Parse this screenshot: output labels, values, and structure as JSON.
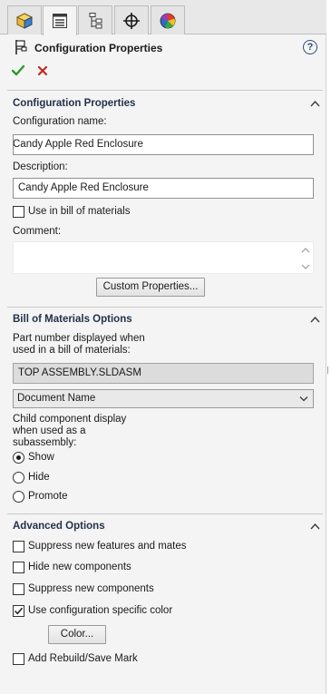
{
  "tabs": [
    {
      "name": "feature-manager",
      "icon": "feature-manager-cube-icon"
    },
    {
      "name": "property-manager",
      "icon": "property-manager-list-icon"
    },
    {
      "name": "configuration-manager",
      "icon": "configuration-manager-tree-icon"
    },
    {
      "name": "dimxpert-manager",
      "icon": "crosshair-target-icon"
    },
    {
      "name": "display-manager",
      "icon": "color-wheel-icon"
    }
  ],
  "header": {
    "title": "Configuration Properties",
    "help_glyph": "?",
    "icon": "configuration-flag-icon"
  },
  "actions": {
    "ok_icon": "green-checkmark-icon",
    "cancel_icon": "red-x-icon"
  },
  "config_section": {
    "title": "Configuration Properties",
    "name_label": "Configuration name:",
    "name_value": "Candy Apple Red Enclosure",
    "description_label": "Description:",
    "description_value": "Candy Apple Red Enclosure",
    "use_in_bom_label": "Use in bill of materials",
    "use_in_bom_checked": false,
    "comment_label": "Comment:",
    "comment_value": "",
    "custom_properties_button": "Custom Properties..."
  },
  "bom_section": {
    "title": "Bill of Materials Options",
    "part_number_label_line1": "Part number displayed when",
    "part_number_label_line2": "used in a bill of materials:",
    "part_number_value": "TOP ASSEMBLY.SLDASM",
    "part_number_source": "Document Name",
    "child_display_label_line1": "Child component display",
    "child_display_label_line2": "when used as a",
    "child_display_label_line3": "subassembly:",
    "options": [
      {
        "label": "Show",
        "selected": true
      },
      {
        "label": "Hide",
        "selected": false
      },
      {
        "label": "Promote",
        "selected": false
      }
    ]
  },
  "advanced_section": {
    "title": "Advanced Options",
    "checks": [
      {
        "label": "Suppress new features and mates",
        "checked": false
      },
      {
        "label": "Hide new components",
        "checked": false
      },
      {
        "label": "Suppress new components",
        "checked": false
      },
      {
        "label": "Use configuration specific color",
        "checked": true
      }
    ],
    "color_button": "Color...",
    "rebuild_label": "Add Rebuild/Save Mark",
    "rebuild_checked": false
  },
  "colors": {
    "section_title": "#24324a",
    "ok_green": "#2e9a2e",
    "cancel_red": "#c8281e",
    "help_blue": "#2e4d7a"
  }
}
